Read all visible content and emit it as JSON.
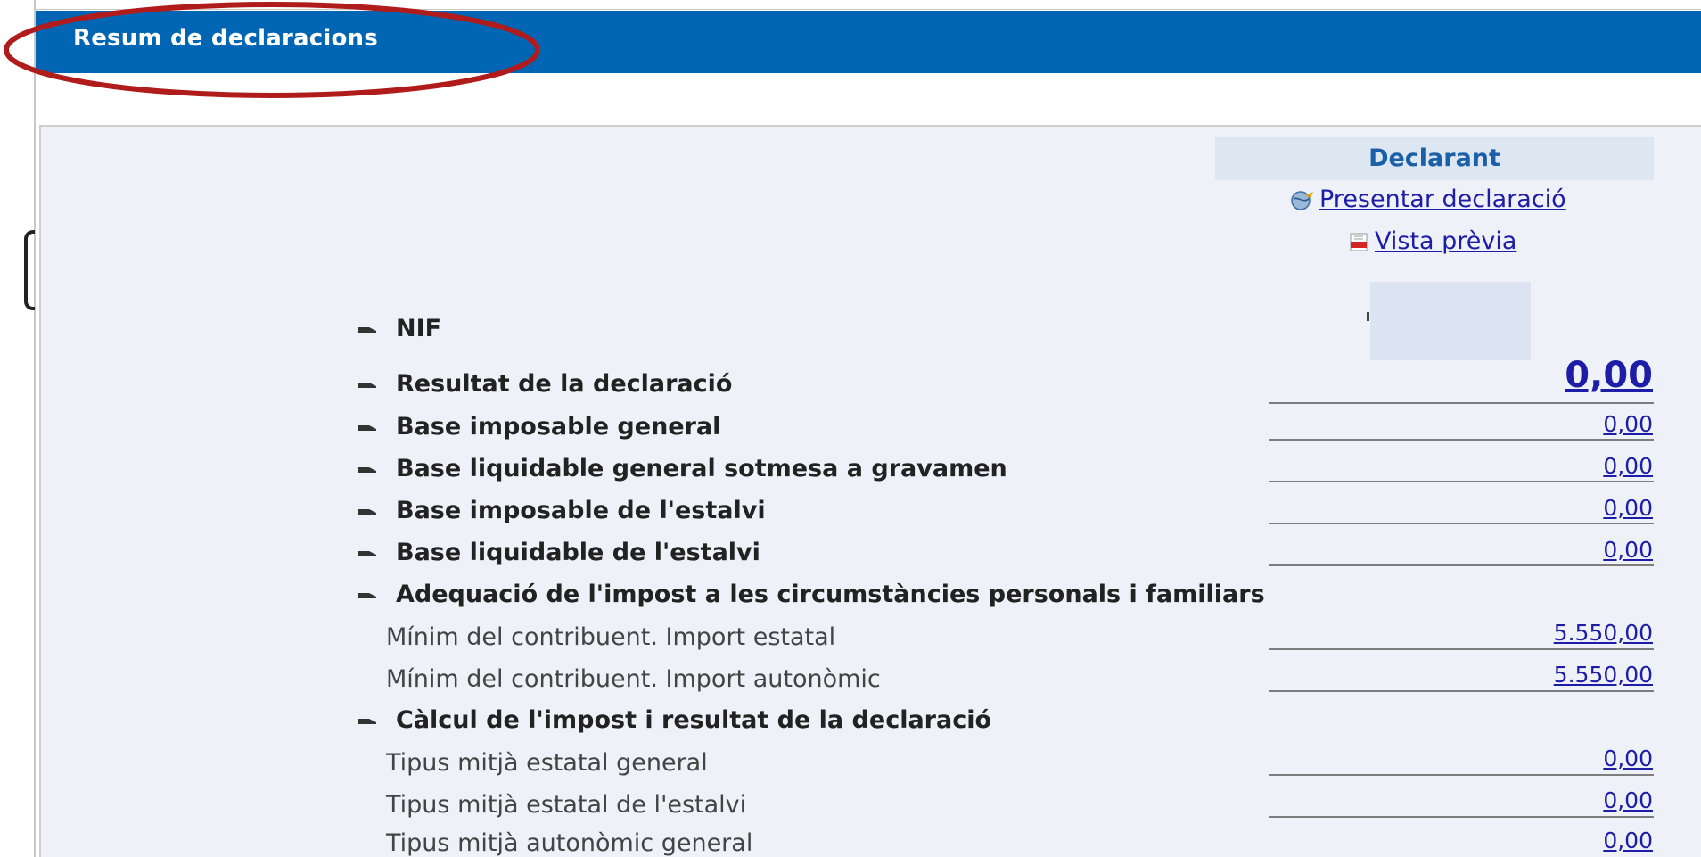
{
  "header": {
    "title": "Resum de declaracions"
  },
  "panel": {
    "column_header": "Declarant",
    "actions": {
      "present": {
        "label": "Presentar declaració",
        "icon": "globe-icon"
      },
      "preview": {
        "label": "Vista prèvia",
        "icon": "pdf-icon"
      }
    },
    "rows": [
      {
        "label": "NIF",
        "value": null,
        "kind": "heading"
      },
      {
        "label": "Resultat de la declaració",
        "value": "0,00",
        "kind": "heading"
      },
      {
        "label": "Base imposable general",
        "value": "0,00",
        "kind": "heading"
      },
      {
        "label": "Base liquidable general sotmesa a gravamen",
        "value": "0,00",
        "kind": "heading"
      },
      {
        "label": "Base imposable de l'estalvi",
        "value": "0,00",
        "kind": "heading"
      },
      {
        "label": "Base liquidable de l'estalvi",
        "value": "0,00",
        "kind": "heading"
      },
      {
        "label": "Adequació de l'impost a les circumstàncies personals i familiars",
        "value": null,
        "kind": "heading"
      },
      {
        "label": "Mínim del contribuent. Import estatal",
        "value": "5.550,00",
        "kind": "sub"
      },
      {
        "label": "Mínim del contribuent. Import autonòmic",
        "value": "5.550,00",
        "kind": "sub"
      },
      {
        "label": "Càlcul de l'impost i resultat de la declaració",
        "value": null,
        "kind": "heading"
      },
      {
        "label": "Tipus mitjà estatal general",
        "value": "0,00",
        "kind": "sub"
      },
      {
        "label": "Tipus mitjà estatal de l'estalvi",
        "value": "0,00",
        "kind": "sub"
      },
      {
        "label": "Tipus mitjà autonòmic general",
        "value": "0,00",
        "kind": "sub"
      }
    ]
  },
  "colors": {
    "header_bg": "#0066b3",
    "panel_bg": "#eef1f8",
    "link": "#1d1da8",
    "annotation": "#b01c1c"
  }
}
